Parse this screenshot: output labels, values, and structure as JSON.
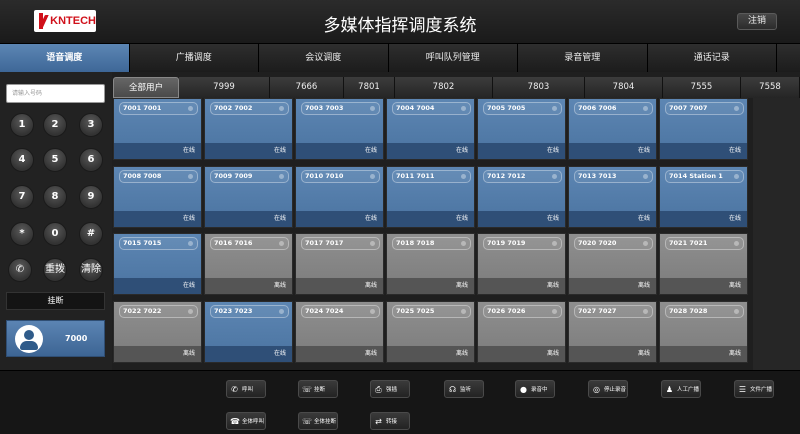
{
  "header": {
    "logo_text": "KNTECH",
    "title": "多媒体指挥调度系统",
    "logout_label": "注销"
  },
  "main_nav": [
    {
      "label": "语音调度",
      "active": true
    },
    {
      "label": "广播调度",
      "active": false
    },
    {
      "label": "会议调度",
      "active": false
    },
    {
      "label": "呼叫队列管理",
      "active": false
    },
    {
      "label": "录音管理",
      "active": false
    },
    {
      "label": "通话记录",
      "active": false
    }
  ],
  "dialpad": {
    "input_placeholder": "请输入号码",
    "keys": [
      "1",
      "2",
      "3",
      "4",
      "5",
      "6",
      "7",
      "8",
      "9",
      "*",
      "0",
      "#"
    ],
    "redial_label": "重拨",
    "clear_label": "清除",
    "hangup_label": "挂断"
  },
  "self_extension": "7000",
  "group_tabs": [
    "全部用户",
    "7999",
    "7666",
    "7801",
    "7802",
    "7803",
    "7804",
    "7555",
    "7558"
  ],
  "status_labels": {
    "online": "在线",
    "offline": "离线"
  },
  "tiles": [
    {
      "name": "7001 7001",
      "status": "online"
    },
    {
      "name": "7002 7002",
      "status": "online"
    },
    {
      "name": "7003 7003",
      "status": "online"
    },
    {
      "name": "7004 7004",
      "status": "online"
    },
    {
      "name": "7005 7005",
      "status": "online"
    },
    {
      "name": "7006 7006",
      "status": "online"
    },
    {
      "name": "7007 7007",
      "status": "online"
    },
    {
      "name": "7008 7008",
      "status": "online"
    },
    {
      "name": "7009 7009",
      "status": "online"
    },
    {
      "name": "7010 7010",
      "status": "online"
    },
    {
      "name": "7011 7011",
      "status": "online"
    },
    {
      "name": "7012 7012",
      "status": "online"
    },
    {
      "name": "7013 7013",
      "status": "online"
    },
    {
      "name": "7014 Station 1",
      "status": "online"
    },
    {
      "name": "7015 7015",
      "status": "online"
    },
    {
      "name": "7016 7016",
      "status": "offline"
    },
    {
      "name": "7017 7017",
      "status": "offline"
    },
    {
      "name": "7018 7018",
      "status": "offline"
    },
    {
      "name": "7019 7019",
      "status": "offline"
    },
    {
      "name": "7020 7020",
      "status": "offline"
    },
    {
      "name": "7021 7021",
      "status": "offline"
    },
    {
      "name": "7022 7022",
      "status": "offline"
    },
    {
      "name": "7023 7023",
      "status": "online"
    },
    {
      "name": "7024 7024",
      "status": "offline"
    },
    {
      "name": "7025 7025",
      "status": "offline"
    },
    {
      "name": "7026 7026",
      "status": "offline"
    },
    {
      "name": "7027 7027",
      "status": "offline"
    },
    {
      "name": "7028 7028",
      "status": "offline"
    }
  ],
  "toolbar": [
    {
      "label": "呼叫",
      "icon": "phone-icon"
    },
    {
      "label": "挂断",
      "icon": "hangup-icon"
    },
    {
      "label": "强插",
      "icon": "barge-in-icon"
    },
    {
      "label": "监听",
      "icon": "headphones-icon"
    },
    {
      "label": "录音中",
      "icon": "microphone-icon"
    },
    {
      "label": "停止录音",
      "icon": "stop-record-icon"
    },
    {
      "label": "人工广播",
      "icon": "person-icon"
    },
    {
      "label": "文件广播",
      "icon": "file-broadcast-icon"
    },
    {
      "label": "全体呼叫",
      "icon": "group-call-icon"
    },
    {
      "label": "全体挂断",
      "icon": "group-hangup-icon"
    },
    {
      "label": "转接",
      "icon": "transfer-icon"
    }
  ],
  "colors": {
    "online_tile": "#5d86b3",
    "offline_tile": "#8f8f8f",
    "active_nav": "#4d76a5",
    "logo_red": "#d0101a"
  }
}
